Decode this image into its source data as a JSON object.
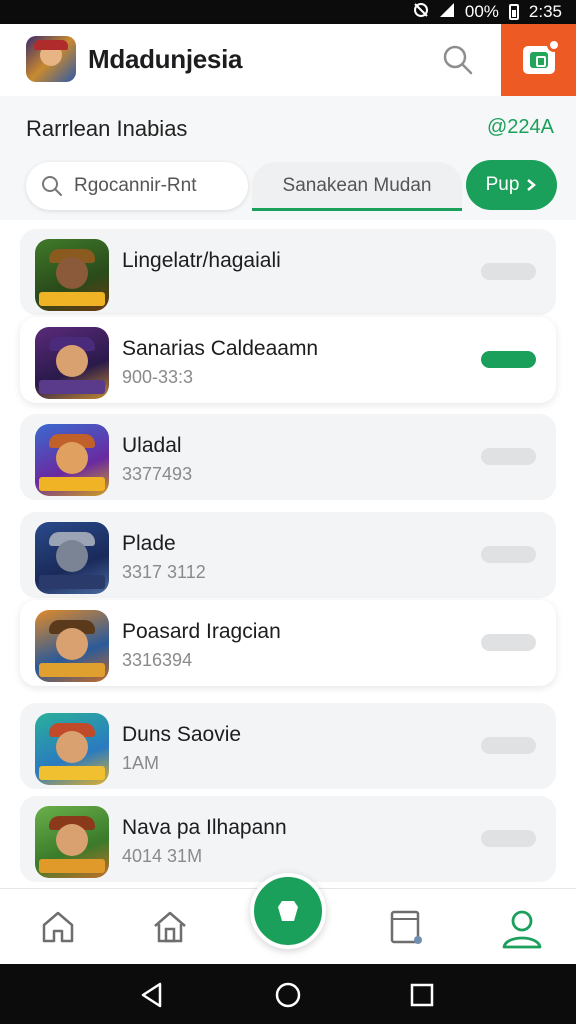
{
  "status_bar": {
    "battery": "00%",
    "time": "2:35"
  },
  "header": {
    "app_title": "Mdadunjesia",
    "search_icon": "search-icon",
    "action_icon": "gift-icon"
  },
  "sub_header": {
    "title": "Rarrlean Inabias",
    "count": "@224A"
  },
  "filters": {
    "search_text": "Rgocannir-Rnt",
    "active_tab": "Sanakean Mudan",
    "button_label": "Pup"
  },
  "list": {
    "items": [
      {
        "title": "Lingelatr/hagaiali",
        "subtitle": "",
        "toggle_on": false,
        "highlight": false
      },
      {
        "title": "Sanarias Caldeaamn",
        "subtitle": "900-33:3",
        "toggle_on": true,
        "highlight": true
      },
      {
        "title": "Uladal",
        "subtitle": "3377493",
        "toggle_on": false,
        "highlight": false
      },
      {
        "title": "Plade",
        "subtitle": "3317 3112",
        "toggle_on": false,
        "highlight": false
      },
      {
        "title": "Poasard Iragcian",
        "subtitle": "3316394",
        "toggle_on": false,
        "highlight": true
      },
      {
        "title": "Duns Saovie",
        "subtitle": "1AM",
        "toggle_on": false,
        "highlight": false
      },
      {
        "title": "Nava pa Ilhapann",
        "subtitle": "4014 31M",
        "toggle_on": false,
        "highlight": false
      }
    ]
  },
  "bottom_nav": {
    "items": [
      "home-icon",
      "home-outline-icon",
      "center-action-icon",
      "tablet-icon",
      "profile-icon"
    ],
    "active": "profile-icon"
  },
  "colors": {
    "accent_green": "#1aa05a",
    "accent_orange": "#ee5a24"
  }
}
